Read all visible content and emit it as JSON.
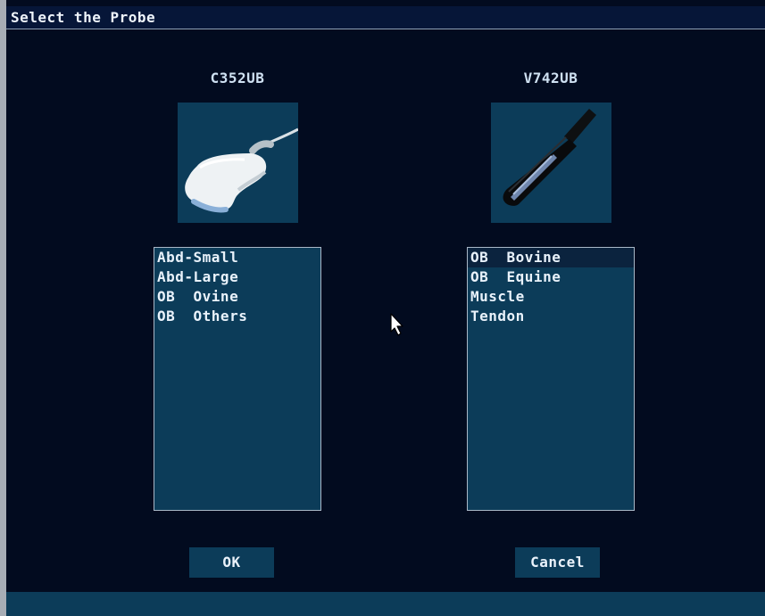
{
  "dialog": {
    "title": "Select the Probe"
  },
  "probes": [
    {
      "name": "C352UB",
      "icon": "convex-probe-icon",
      "presets": [
        "Abd-Small",
        "Abd-Large",
        "OB  Ovine",
        "OB  Others"
      ],
      "selected_index": null
    },
    {
      "name": "V742UB",
      "icon": "rectal-linear-probe-icon",
      "presets": [
        "OB  Bovine",
        "OB  Equine",
        "Muscle",
        "Tendon"
      ],
      "selected_index": 0
    }
  ],
  "buttons": {
    "ok_label": "OK",
    "cancel_label": "Cancel"
  },
  "colors": {
    "background": "#020b1f",
    "panel": "#0c3c59",
    "selected_row": "#0b233e",
    "text": "#e9f2fb"
  }
}
